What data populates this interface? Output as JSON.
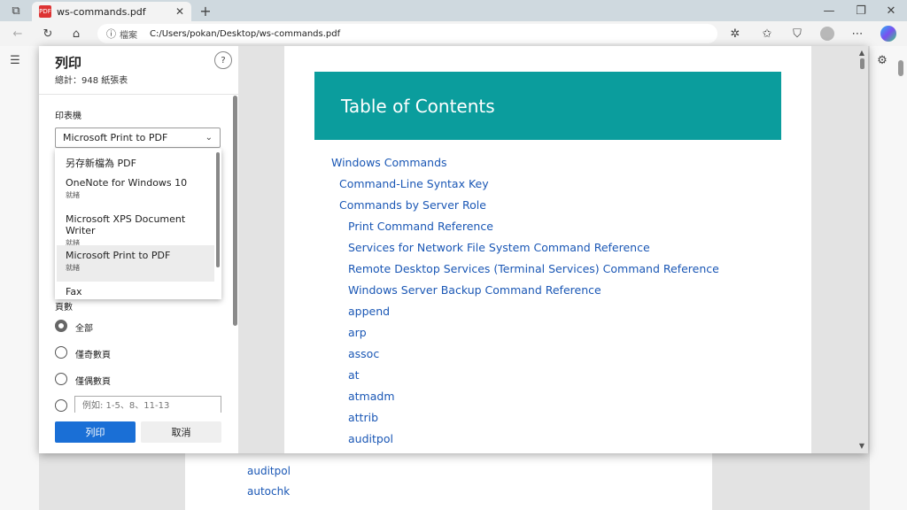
{
  "browser": {
    "tab_title": "ws-commands.pdf",
    "address_label": "檔案",
    "address": "C:/Users/pokan/Desktop/ws-commands.pdf"
  },
  "background_pdf": {
    "links": [
      "auditpol",
      "autochk"
    ]
  },
  "print_panel": {
    "title": "列印",
    "subtitle": "總計：948 紙張表",
    "help": "?",
    "printer_label": "印表機",
    "printer_selected": "Microsoft Print to PDF",
    "printer_options": [
      {
        "name": "另存新檔為 PDF",
        "status": ""
      },
      {
        "name": "OneNote for Windows 10",
        "status": "就緒"
      },
      {
        "name": "Microsoft XPS Document Writer",
        "status": "就緒"
      },
      {
        "name": "Microsoft Print to PDF",
        "status": "就緒"
      },
      {
        "name": "Fax",
        "status": ""
      }
    ],
    "pages_label": "頁數",
    "page_options": [
      "全部",
      "僅奇數頁",
      "僅偶數頁"
    ],
    "page_range_placeholder": "例如: 1-5、8、11-13",
    "print_button": "列印",
    "cancel_button": "取消"
  },
  "preview": {
    "banner": "Table of Contents",
    "toc": [
      "Windows Commands",
      "Command-Line Syntax Key",
      "Commands by Server Role",
      "Print Command Reference",
      "Services for Network File System Command Reference",
      "Remote Desktop Services (Terminal Services) Command Reference",
      "Windows Server Backup Command Reference",
      "append",
      "arp",
      "assoc",
      "at",
      "atmadm",
      "attrib",
      "auditpol"
    ]
  },
  "colors": {
    "accent": "#1a6fd6",
    "banner": "#0b9d9d",
    "link": "#1a57b5"
  }
}
